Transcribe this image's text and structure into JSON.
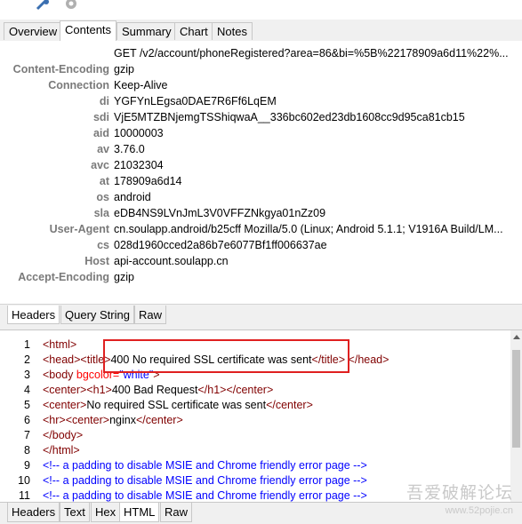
{
  "main_tabs": [
    "Overview",
    "Contents",
    "Summary",
    "Chart",
    "Notes"
  ],
  "request_line": "GET /v2/account/phoneRegistered?area=86&bi=%5B%22178909a6d11%22%...",
  "headers": [
    {
      "key": "Content-Encoding",
      "value": "gzip"
    },
    {
      "key": "Connection",
      "value": "Keep-Alive"
    },
    {
      "key": "di",
      "value": "YGFYnLEgsa0DAE7R6Ff6LqEM"
    },
    {
      "key": "sdi",
      "value": "VjE5MTZBNjemgTSShiqwaA__336bc602ed23db1608cc9d95ca81cb15"
    },
    {
      "key": "aid",
      "value": "10000003"
    },
    {
      "key": "av",
      "value": "3.76.0"
    },
    {
      "key": "avc",
      "value": "21032304"
    },
    {
      "key": "at",
      "value": "178909a6d14"
    },
    {
      "key": "os",
      "value": "android"
    },
    {
      "key": "sla",
      "value": "eDB4NS9LVnJmL3V0VFFZNkgya01nZz09"
    },
    {
      "key": "User-Agent",
      "value": "cn.soulapp.android/b25cff Mozilla/5.0 (Linux; Android 5.1.1; V1916A Build/LM..."
    },
    {
      "key": "cs",
      "value": "028d1960cced2a86b7e6077Bf1ff006637ae"
    },
    {
      "key": "Host",
      "value": "api-account.soulapp.cn"
    },
    {
      "key": "Accept-Encoding",
      "value": "gzip"
    }
  ],
  "request_subtabs": [
    "Headers",
    "Query String",
    "Raw"
  ],
  "response_lines": {
    "l1": {
      "n": "1",
      "open": "<html>"
    },
    "l2": {
      "n": "2",
      "head_open": "<head>",
      "title_open": "<title>",
      "title_text": "400 No required SSL certificate was sent",
      "title_close": "</title>",
      "head_close": "</head>"
    },
    "l3": {
      "n": "3",
      "body_tag": "<body ",
      "attr": "bgcolor",
      "eq": "=",
      "val": "\"white\"",
      "close": ">"
    },
    "l4": {
      "n": "4",
      "center": "<center>",
      "h1": "<h1>",
      "text": "400 Bad Request",
      "h1_close": "</h1>",
      "center_close": "</center>"
    },
    "l5": {
      "n": "5",
      "center": "<center>",
      "text": "No required SSL certificate was sent",
      "center_close": "</center>"
    },
    "l6": {
      "n": "6",
      "hr": "<hr>",
      "center": "<center>",
      "text": "nginx",
      "center_close": "</center>"
    },
    "l7": {
      "n": "7",
      "text": "</body>"
    },
    "l8": {
      "n": "8",
      "text": "</html>"
    },
    "l9": {
      "n": "9",
      "text": "<!-- a padding to disable MSIE and Chrome friendly error page -->"
    },
    "l10": {
      "n": "10",
      "text": "<!-- a padding to disable MSIE and Chrome friendly error page -->"
    },
    "l11": {
      "n": "11",
      "text": "<!-- a padding to disable MSIE and Chrome friendly error page -->"
    }
  },
  "response_tabs": [
    "Headers",
    "Text",
    "Hex",
    "HTML",
    "Raw"
  ],
  "watermark": {
    "line1": "吾爱破解论坛",
    "line2": "www.52pojie.cn"
  },
  "colors": {
    "highlight": "#e02020",
    "tag": "#800000",
    "comment": "#0000ff"
  }
}
